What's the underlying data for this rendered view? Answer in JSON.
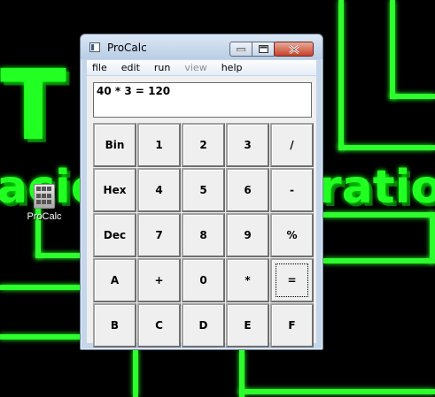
{
  "desktop": {
    "icon_label": "ProCalc",
    "wallpaper_text_1": "acio",
    "wallpaper_text_2": "ratio",
    "accent_color": "#2cff2c"
  },
  "window": {
    "title": "ProCalc",
    "controls": {
      "minimize": "minimize-icon",
      "maximize": "maximize-icon",
      "close": "close-icon"
    }
  },
  "menu": [
    "file",
    "edit",
    "run",
    "view",
    "help"
  ],
  "display": {
    "text": "40 * 3 = 120"
  },
  "keys": [
    [
      "Bin",
      "1",
      "2",
      "3",
      "/"
    ],
    [
      "Hex",
      "4",
      "5",
      "6",
      "-"
    ],
    [
      "Dec",
      "7",
      "8",
      "9",
      "%"
    ],
    [
      "A",
      "+",
      "0",
      "*",
      "="
    ],
    [
      "B",
      "C",
      "D",
      "E",
      "F"
    ]
  ]
}
